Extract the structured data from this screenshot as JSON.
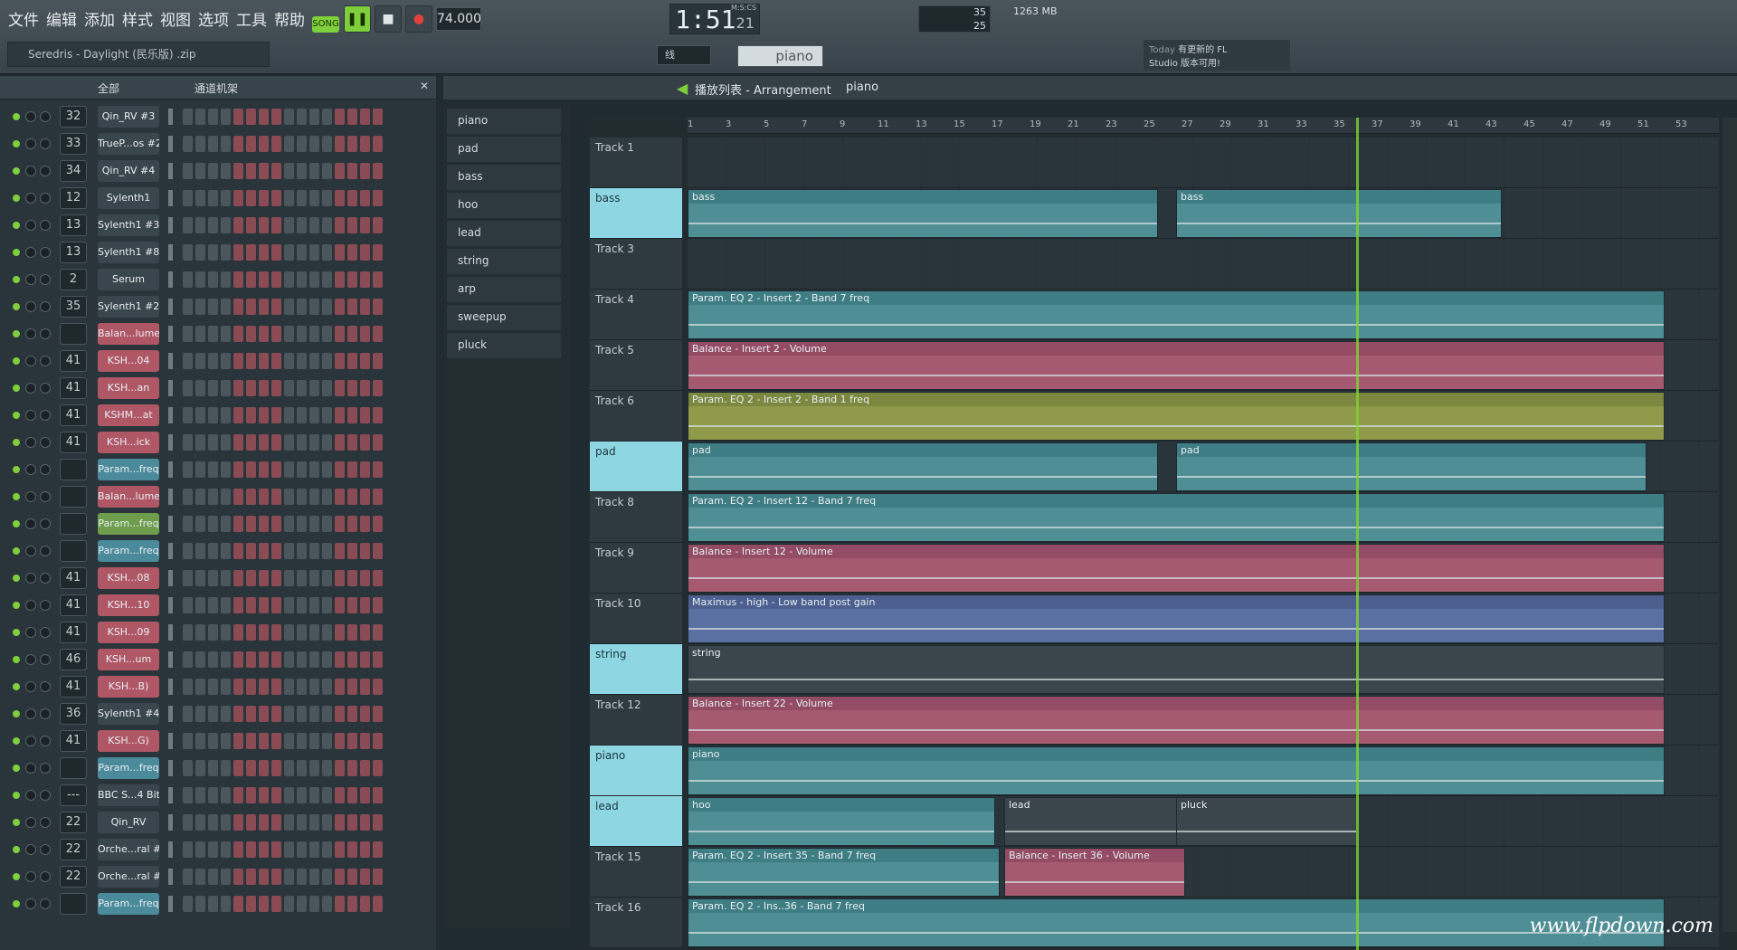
{
  "menu": [
    "文件",
    "编辑",
    "添加",
    "样式",
    "视图",
    "选项",
    "工具",
    "帮助"
  ],
  "transport": {
    "mode": "SONG",
    "tempo": "74.000",
    "time": "1:51",
    "time_sub": "21",
    "time_label": "M:S:CS",
    "memory": "1263 MB",
    "cpu": "35",
    "poly": "25"
  },
  "hint": "Seredris - Daylight (民乐版) .zip",
  "news": {
    "day": "Today",
    "line1": "有更新的 FL",
    "line2": "Studio 版本可用!"
  },
  "snap": "线",
  "pattern": "piano",
  "rack": {
    "filter": "全部",
    "title": "通道机架",
    "channels": [
      {
        "num": "32",
        "name": "Qin_RV #3",
        "style": "plain"
      },
      {
        "num": "33",
        "name": "TrueP...os #2",
        "style": "plain"
      },
      {
        "num": "34",
        "name": "Qin_RV #4",
        "style": "plain"
      },
      {
        "num": "12",
        "name": "Sylenth1",
        "style": "plain"
      },
      {
        "num": "13",
        "name": "Sylenth1 #3",
        "style": "plain"
      },
      {
        "num": "13",
        "name": "Sylenth1 #8",
        "style": "plain"
      },
      {
        "num": "2",
        "name": "Serum",
        "style": "plain"
      },
      {
        "num": "35",
        "name": "Sylenth1 #2",
        "style": "plain"
      },
      {
        "num": "",
        "name": "Balan...lume",
        "style": "red"
      },
      {
        "num": "41",
        "name": "KSH...04",
        "style": "red"
      },
      {
        "num": "41",
        "name": "KSH...an",
        "style": "red"
      },
      {
        "num": "41",
        "name": "KSHM...at",
        "style": "red"
      },
      {
        "num": "41",
        "name": "KSH...ick",
        "style": "red"
      },
      {
        "num": "",
        "name": "Param...freq",
        "style": "blu"
      },
      {
        "num": "",
        "name": "Balan...lume",
        "style": "red"
      },
      {
        "num": "",
        "name": "Param...freq",
        "style": "grn"
      },
      {
        "num": "",
        "name": "Param...freq",
        "style": "blu"
      },
      {
        "num": "41",
        "name": "KSH...08",
        "style": "red"
      },
      {
        "num": "41",
        "name": "KSH...10",
        "style": "red"
      },
      {
        "num": "41",
        "name": "KSH...09",
        "style": "red"
      },
      {
        "num": "46",
        "name": "KSH...um",
        "style": "red"
      },
      {
        "num": "41",
        "name": "KSH...B)",
        "style": "red"
      },
      {
        "num": "36",
        "name": "Sylenth1 #4",
        "style": "plain"
      },
      {
        "num": "41",
        "name": "KSH...G)",
        "style": "red"
      },
      {
        "num": "",
        "name": "Param...freq",
        "style": "blu"
      },
      {
        "num": "---",
        "name": "BBC S...4 Bit)",
        "style": "plain"
      },
      {
        "num": "22",
        "name": "Qin_RV",
        "style": "plain"
      },
      {
        "num": "22",
        "name": "Orche...ral #2",
        "style": "plain"
      },
      {
        "num": "22",
        "name": "Orche...ral #3",
        "style": "plain"
      },
      {
        "num": "",
        "name": "Param...freq",
        "style": "blu"
      }
    ]
  },
  "picker": [
    "piano",
    "pad",
    "bass",
    "hoo",
    "lead",
    "string",
    "arp",
    "sweepup",
    "pluck"
  ],
  "playlist": {
    "title": "播放列表 - Arrangement",
    "crumb": "piano",
    "ruler": [
      "1",
      "3",
      "5",
      "7",
      "9",
      "11",
      "13",
      "15",
      "17",
      "19",
      "21",
      "23",
      "25",
      "27",
      "29",
      "31",
      "33",
      "35",
      "37",
      "39",
      "41",
      "43",
      "45",
      "47",
      "49",
      "51",
      "53"
    ],
    "tracks": [
      {
        "name": "Track 1",
        "hl": false,
        "clips": []
      },
      {
        "name": "bass",
        "hl": true,
        "clips": [
          {
            "label": "bass",
            "cls": "cT",
            "repeat": "bass"
          }
        ]
      },
      {
        "name": "Track 3",
        "hl": false,
        "clips": []
      },
      {
        "name": "Track 4",
        "hl": false,
        "clips": [
          {
            "label": "Param. EQ 2 - Insert 2 - Band 7 freq",
            "cls": "cT"
          }
        ]
      },
      {
        "name": "Track 5",
        "hl": false,
        "clips": [
          {
            "label": "Balance - Insert 2 - Volume",
            "cls": "cR"
          }
        ]
      },
      {
        "name": "Track 6",
        "hl": false,
        "clips": [
          {
            "label": "Param. EQ 2 - Insert 2 - Band 1 freq",
            "cls": "cY"
          }
        ]
      },
      {
        "name": "pad",
        "hl": true,
        "clips": [
          {
            "label": "pad",
            "cls": "cT",
            "repeat": "pad"
          }
        ]
      },
      {
        "name": "Track 8",
        "hl": false,
        "clips": [
          {
            "label": "Param. EQ 2 - Insert 12 - Band 7 freq",
            "cls": "cT"
          }
        ]
      },
      {
        "name": "Track 9",
        "hl": false,
        "clips": [
          {
            "label": "Balance - Insert 12 - Volume",
            "cls": "cR"
          }
        ]
      },
      {
        "name": "Track 10",
        "hl": false,
        "clips": [
          {
            "label": "Maximus - high - Low band post gain",
            "cls": "cB"
          }
        ]
      },
      {
        "name": "string",
        "hl": true,
        "clips": [
          {
            "label": "string",
            "cls": "cP"
          }
        ]
      },
      {
        "name": "Track 12",
        "hl": false,
        "clips": [
          {
            "label": "Balance - Insert 22 - Volume",
            "cls": "cR"
          }
        ]
      },
      {
        "name": "piano",
        "hl": true,
        "clips": [
          {
            "label": "piano",
            "cls": "cT"
          }
        ]
      },
      {
        "name": "lead",
        "hl": true,
        "clips": [
          {
            "label": "hoo",
            "cls": "cT",
            "repeat": "hoo"
          },
          {
            "label": "lead",
            "cls": "cP"
          },
          {
            "label": "pluck",
            "cls": "cP"
          }
        ]
      },
      {
        "name": "Track 15",
        "hl": false,
        "clips": [
          {
            "label": "Param. EQ 2 - Insert 35 - Band 7 freq",
            "cls": "cT"
          },
          {
            "label": "Balance - Insert 36 - Volume",
            "cls": "cR"
          }
        ]
      },
      {
        "name": "Track 16",
        "hl": false,
        "clips": [
          {
            "label": "Param. EQ 2 - Ins..36 - Band 7 freq",
            "cls": "cT"
          }
        ]
      }
    ]
  },
  "watermark": "www.flpdown.com"
}
